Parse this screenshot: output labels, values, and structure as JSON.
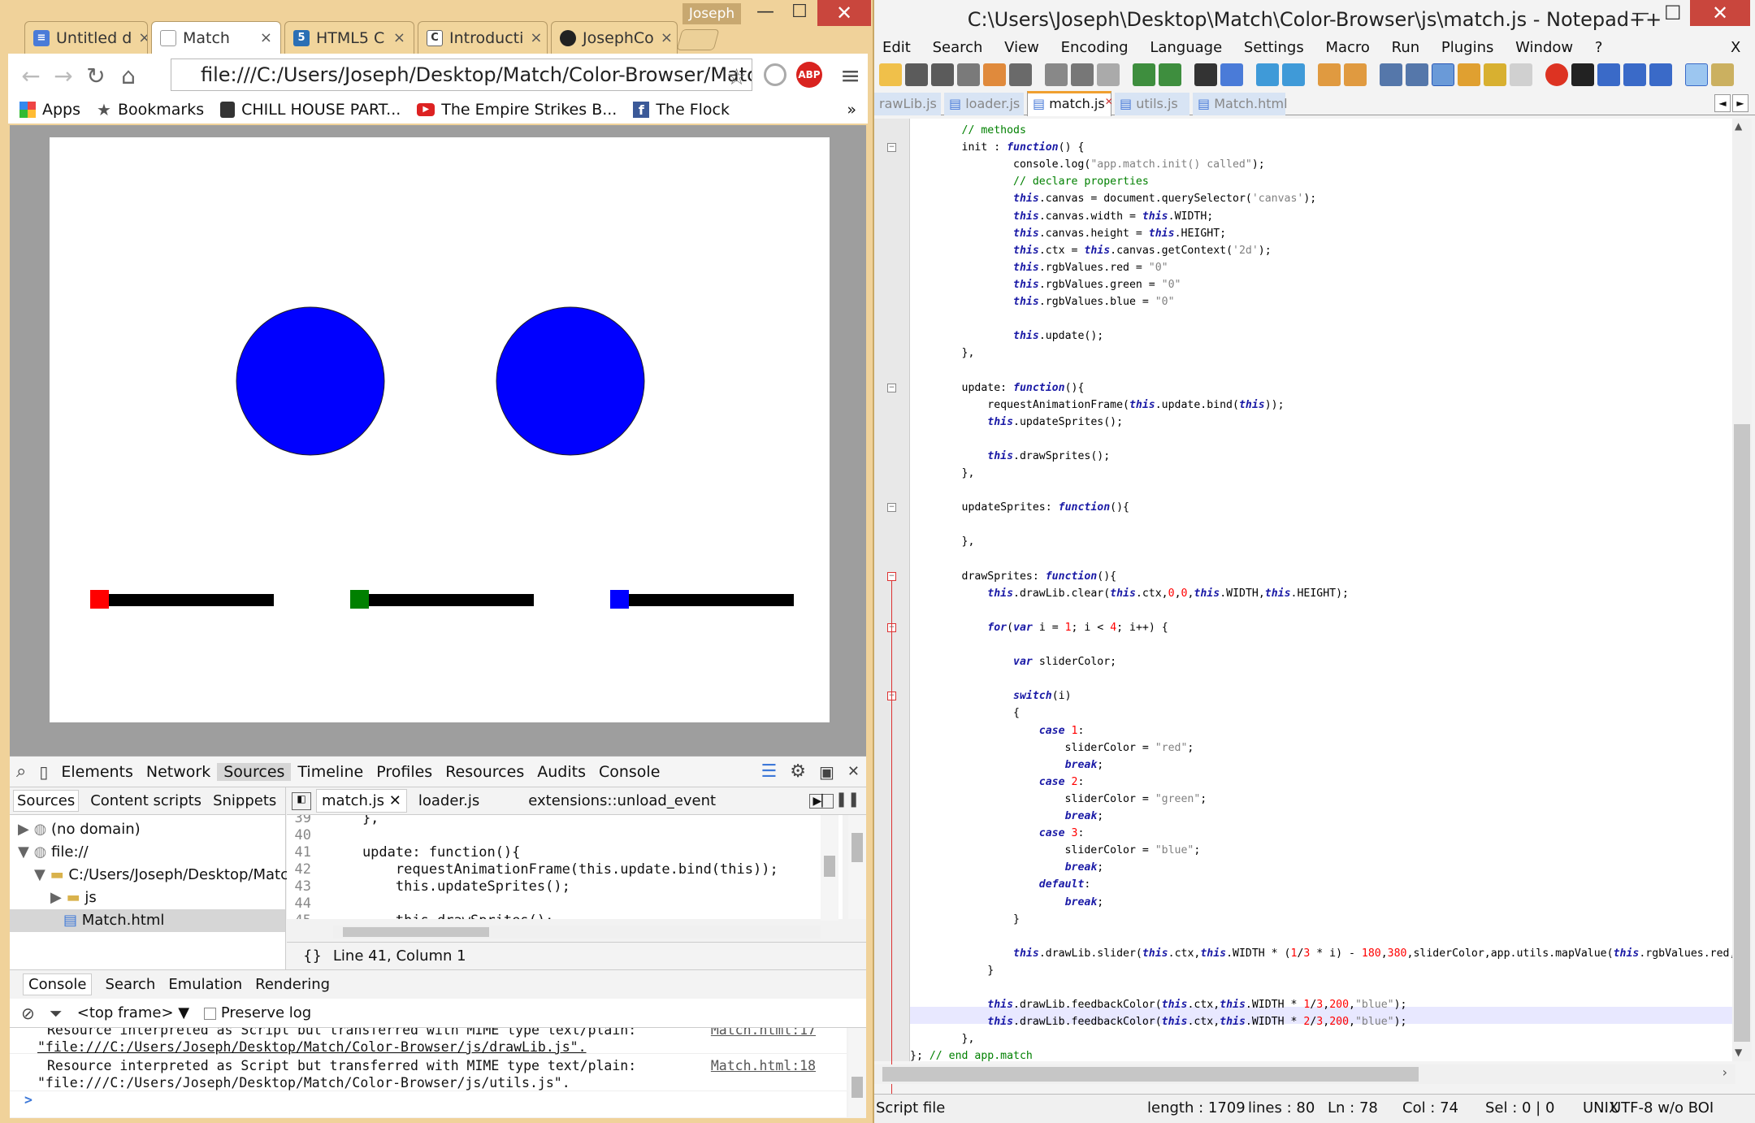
{
  "chrome": {
    "user": "Joseph",
    "tabs": [
      {
        "label": "Untitled d",
        "icon": "docs-icon"
      },
      {
        "label": "Match",
        "icon": "page-icon"
      },
      {
        "label": "HTML5 C",
        "icon": "html5-icon"
      },
      {
        "label": "Introducti",
        "icon": "c-icon"
      },
      {
        "label": "JosephCo",
        "icon": "github-icon"
      }
    ],
    "url": "file:///C:/Users/Joseph/Desktop/Match/Color-Browser/Match.h",
    "bookmarks": [
      {
        "label": "Apps",
        "icon": "apps-icon"
      },
      {
        "label": "Bookmarks",
        "icon": "star-icon"
      },
      {
        "label": "CHILL HOUSE PART...",
        "icon": "bookmark-icon"
      },
      {
        "label": "The Empire Strikes B...",
        "icon": "youtube-icon"
      },
      {
        "label": "The Flock",
        "icon": "facebook-icon"
      }
    ],
    "bookmarks_more": "»",
    "page": {
      "circle_color": "#0000ff",
      "sliders": [
        {
          "color": "#ff0000"
        },
        {
          "color": "#008000"
        },
        {
          "color": "#0000ff"
        }
      ]
    }
  },
  "devtools": {
    "tabs": [
      "Elements",
      "Network",
      "Sources",
      "Timeline",
      "Profiles",
      "Resources",
      "Audits",
      "Console"
    ],
    "sidebar_tabs": [
      "Sources",
      "Content scripts",
      "Snippets"
    ],
    "tree": [
      "(no domain)",
      "file://",
      "C:/Users/Joseph/Desktop/Match/",
      "js",
      "Match.html"
    ],
    "file_tabs": [
      "match.js",
      "loader.js",
      "extensions::unload_event"
    ],
    "code_lines": [
      {
        "n": "39",
        "t": "    },"
      },
      {
        "n": "40",
        "t": ""
      },
      {
        "n": "41",
        "t": "    update: function(){"
      },
      {
        "n": "42",
        "t": "        requestAnimationFrame(this.update.bind(this));"
      },
      {
        "n": "43",
        "t": "        this.updateSprites();"
      },
      {
        "n": "44",
        "t": ""
      },
      {
        "n": "45",
        "t": "        this.drawSprites();"
      }
    ],
    "status": "Line 41, Column 1",
    "status_icon": "{}",
    "drawer_tabs": [
      "Console",
      "Search",
      "Emulation",
      "Rendering"
    ],
    "frame": "<top frame>",
    "preserve": "Preserve log",
    "messages": [
      {
        "text": "Resource interpreted as Script but transferred with MIME type text/plain:",
        "link": "\"file:///C:/Users/Joseph/Desktop/Match/Color-Browser/js/drawLib.js\".",
        "src": "Match.html:17"
      },
      {
        "text": "Resource interpreted as Script but transferred with MIME type text/plain:",
        "link": "\"file:///C:/Users/Joseph/Desktop/Match/Color-Browser/js/utils.js\".",
        "src": "Match.html:18"
      }
    ],
    "prompt": ">"
  },
  "npp": {
    "title": "C:\\Users\\Joseph\\Desktop\\Match\\Color-Browser\\js\\match.js - Notepad++",
    "menu": [
      "Edit",
      "Search",
      "View",
      "Encoding",
      "Language",
      "Settings",
      "Macro",
      "Run",
      "Plugins",
      "Window",
      "?"
    ],
    "menu_close": "X",
    "tabs": [
      "rawLib.js",
      "loader.js",
      "match.js",
      "utils.js",
      "Match.html"
    ],
    "tab_arrows": [
      "◄",
      "►"
    ],
    "status": {
      "type": "Script file",
      "length": "length : 1709",
      "lines": "lines : 80",
      "ln": "Ln : 78",
      "col": "Col : 74",
      "sel": "Sel : 0 | 0",
      "eol": "UNIX",
      "enc": "UTF-8 w/o BOI"
    }
  }
}
